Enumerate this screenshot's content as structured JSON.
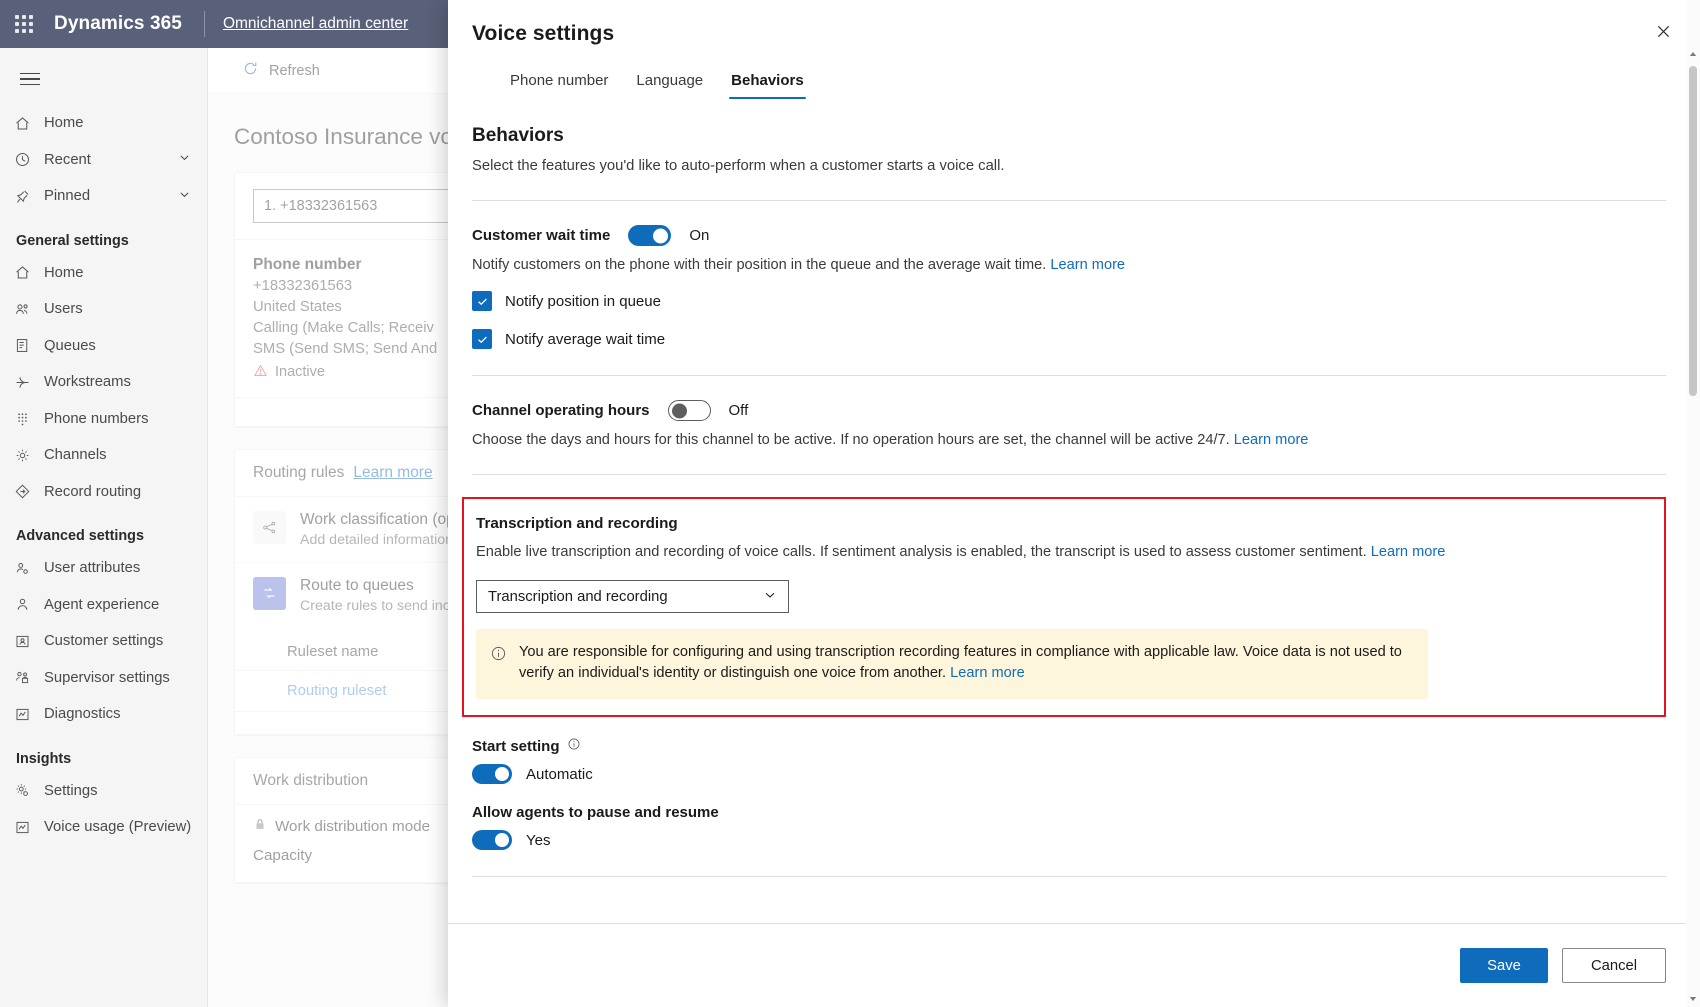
{
  "topbar": {
    "waffle_icon": "app-launcher-icon",
    "brand": "Dynamics 365",
    "app_name": "Omnichannel admin center"
  },
  "sidebar": {
    "menu_icon": "hamburger-icon",
    "top_items": [
      {
        "label": "Home",
        "icon": "home-icon",
        "chevron": false
      },
      {
        "label": "Recent",
        "icon": "clock-icon",
        "chevron": true
      },
      {
        "label": "Pinned",
        "icon": "pin-icon",
        "chevron": true
      }
    ],
    "groups": [
      {
        "title": "General settings",
        "items": [
          {
            "label": "Home",
            "icon": "home-icon"
          },
          {
            "label": "Users",
            "icon": "users-icon"
          },
          {
            "label": "Queues",
            "icon": "queues-icon"
          },
          {
            "label": "Workstreams",
            "icon": "workstreams-icon"
          },
          {
            "label": "Phone numbers",
            "icon": "dialpad-icon"
          },
          {
            "label": "Channels",
            "icon": "gear-icon"
          },
          {
            "label": "Record routing",
            "icon": "diamond-arrow-icon"
          }
        ]
      },
      {
        "title": "Advanced settings",
        "items": [
          {
            "label": "User attributes",
            "icon": "user-attributes-icon"
          },
          {
            "label": "Agent experience",
            "icon": "agent-icon"
          },
          {
            "label": "Customer settings",
            "icon": "customer-card-icon"
          },
          {
            "label": "Supervisor settings",
            "icon": "supervisor-icon"
          },
          {
            "label": "Diagnostics",
            "icon": "chart-icon"
          }
        ]
      },
      {
        "title": "Insights",
        "items": [
          {
            "label": "Settings",
            "icon": "gear-settings-icon"
          },
          {
            "label": "Voice usage (Preview)",
            "icon": "chart-icon"
          }
        ]
      }
    ]
  },
  "content": {
    "command_bar": {
      "refresh_label": "Refresh",
      "refresh_icon": "refresh-icon"
    },
    "page_title": "Contoso Insurance voi",
    "phone_card": {
      "selector_value": "1. +18332361563",
      "title": "Phone number",
      "lines": [
        "+18332361563",
        "United States",
        "Calling (Make Calls; Receiv",
        "SMS (Send SMS; Send And"
      ],
      "status": "Inactive",
      "status_icon": "warning-triangle-icon"
    },
    "routing_card": {
      "header": "Routing rules",
      "header_link": "Learn more",
      "rows": [
        {
          "icon": "share-nodes-icon",
          "title": "Work classification (opti",
          "subtitle": "Add detailed information to"
        },
        {
          "icon": "route-icon",
          "title": "Route to queues",
          "subtitle": "Create rules to send incom"
        }
      ],
      "table_header": "Ruleset name",
      "table_row": "Routing ruleset"
    },
    "work_distribution": {
      "header": "Work distribution",
      "mode_label": "Work distribution mode",
      "mode_icon": "lock-icon",
      "capacity_label": "Capacity"
    }
  },
  "panel": {
    "title": "Voice settings",
    "close_icon": "close-icon",
    "tabs": [
      {
        "label": "Phone number",
        "active": false
      },
      {
        "label": "Language",
        "active": false
      },
      {
        "label": "Behaviors",
        "active": true
      }
    ],
    "section": {
      "heading": "Behaviors",
      "subheading": "Select the features you'd like to auto-perform when a customer starts a voice call."
    },
    "customer_wait_time": {
      "label": "Customer wait time",
      "toggle_state": "On",
      "toggle_on": true,
      "helper": "Notify customers on the phone with their position in the queue and the average wait time.",
      "helper_link": "Learn more",
      "checkboxes": [
        {
          "label": "Notify position in queue",
          "checked": true
        },
        {
          "label": "Notify average wait time",
          "checked": true
        }
      ]
    },
    "channel_operating_hours": {
      "label": "Channel operating hours",
      "toggle_state": "Off",
      "toggle_on": false,
      "helper": "Choose the days and hours for this channel to be active. If no operation hours are set, the channel will be active 24/7.",
      "helper_link": "Learn more"
    },
    "transcription": {
      "highlight_color": "#e81123",
      "title": "Transcription and recording",
      "description": "Enable live transcription and recording of voice calls. If sentiment analysis is enabled, the transcript is used to assess customer sentiment.",
      "description_link": "Learn more",
      "dropdown_value": "Transcription and recording",
      "dropdown_icon": "chevron-down-icon",
      "banner_icon": "info-icon",
      "banner_text": "You are responsible for configuring and using transcription recording features in compliance with applicable law. Voice data is not used to verify an individual's identity or distinguish one voice from another.",
      "banner_link": "Learn more"
    },
    "start_setting": {
      "label": "Start setting",
      "info_icon": "info-icon",
      "toggle_state": "Automatic",
      "toggle_on": true
    },
    "allow_pause": {
      "label": "Allow agents to pause and resume",
      "toggle_state": "Yes",
      "toggle_on": true
    },
    "footer": {
      "save_label": "Save",
      "cancel_label": "Cancel"
    }
  },
  "scrollbar": {
    "up_icon": "caret-up-icon",
    "down_icon": "caret-down-icon"
  }
}
